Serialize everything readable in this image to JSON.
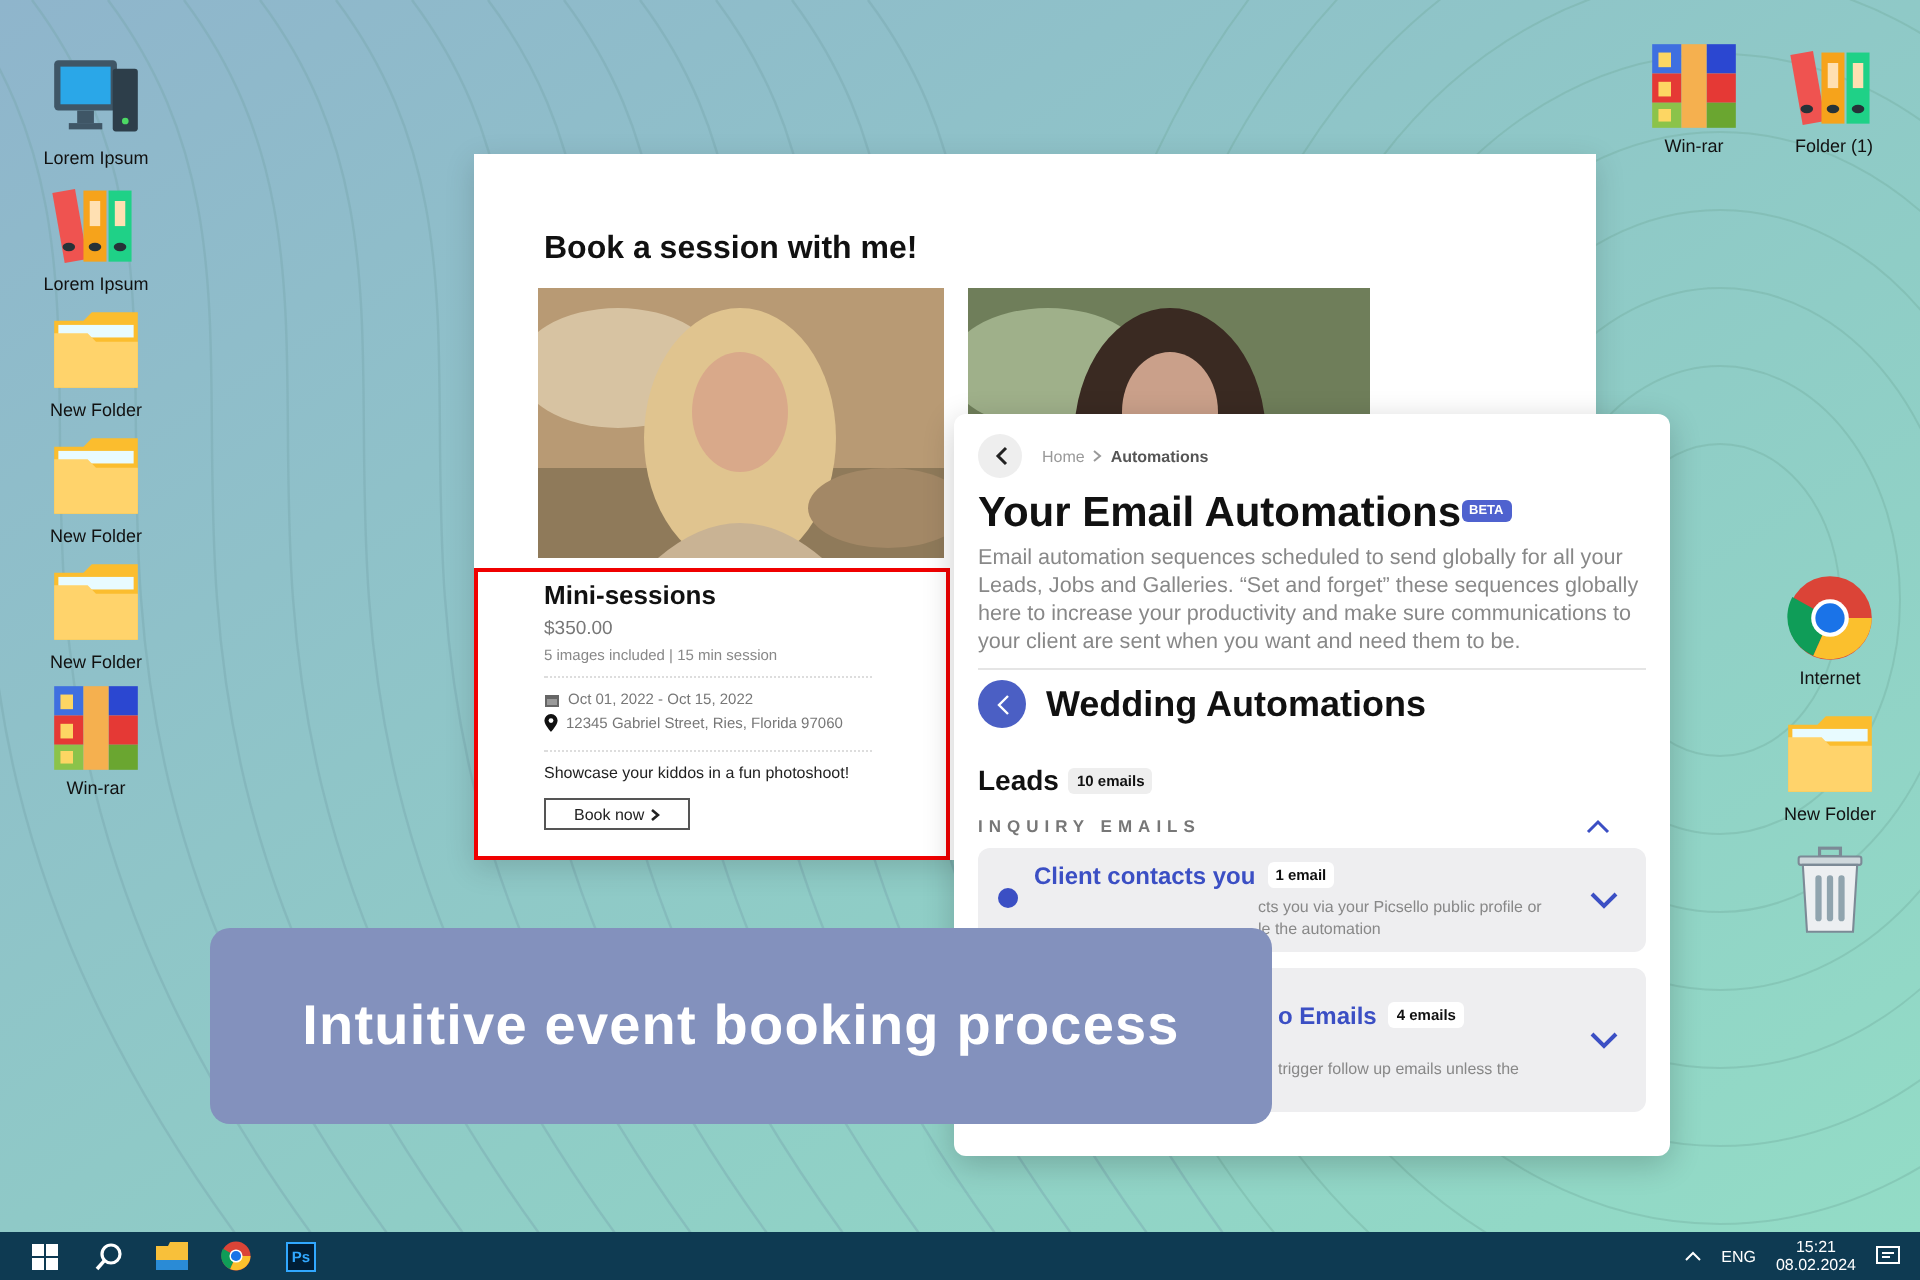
{
  "desktop": {
    "left_icons": [
      {
        "label": "Lorem Ipsum",
        "kind": "computer"
      },
      {
        "label": "Lorem Ipsum",
        "kind": "binders"
      },
      {
        "label": "New Folder",
        "kind": "folder"
      },
      {
        "label": "New Folder",
        "kind": "folder"
      },
      {
        "label": "New Folder",
        "kind": "folder"
      },
      {
        "label": "Win-rar",
        "kind": "archive"
      }
    ],
    "top_right_icons": [
      {
        "label": "Win-rar",
        "kind": "archive"
      },
      {
        "label": "Folder (1)",
        "kind": "binders"
      }
    ],
    "right_icons": [
      {
        "label": "Internet",
        "kind": "browser"
      },
      {
        "label": "New Folder",
        "kind": "folder"
      },
      {
        "kind": "trash"
      }
    ]
  },
  "booking_window": {
    "title": "Book a session with me!",
    "card": {
      "highlighted": true,
      "title": "Mini-sessions",
      "price": "$350.00",
      "details": "5 images included | 15 min session",
      "dates": "Oct 01, 2022 - Oct 15, 2022",
      "address": "12345 Gabriel Street, Ries, Florida 97060",
      "description": "Showcase your kiddos in a fun photoshoot!",
      "button": "Book now"
    }
  },
  "automations_window": {
    "breadcrumb": [
      "Home",
      "Automations"
    ],
    "title": "Your Email Automations",
    "badge": "BETA",
    "description": "Email automation sequences scheduled to send globally for all your Leads, Jobs and Galleries. “Set and forget” these sequences globally here to increase your productivity and make sure communications to your client are sent when you want and need them to be.",
    "section": "Wedding Automations",
    "group": {
      "title": "Leads",
      "count": "10 emails"
    },
    "category": {
      "label": "INQUIRY EMAILS",
      "expanded": true
    },
    "items": [
      {
        "title": "Client contacts you",
        "count": "1 email",
        "description_lines": [
          "cts you via your Picsello public profile or",
          "le the automation"
        ],
        "expanded": false
      },
      {
        "title": "o Emails",
        "count": "4 emails",
        "description_lines": [
          "trigger follow up emails unless the"
        ],
        "expanded": false
      }
    ]
  },
  "banner": {
    "text": "Intuitive event booking process"
  },
  "taskbar": {
    "apps": [
      {
        "kind": "start"
      },
      {
        "kind": "search"
      },
      {
        "kind": "files"
      },
      {
        "kind": "browser"
      },
      {
        "kind": "ps",
        "label": "Ps"
      }
    ],
    "language": "ENG",
    "time": "15:21",
    "date": "08.02.2024"
  }
}
